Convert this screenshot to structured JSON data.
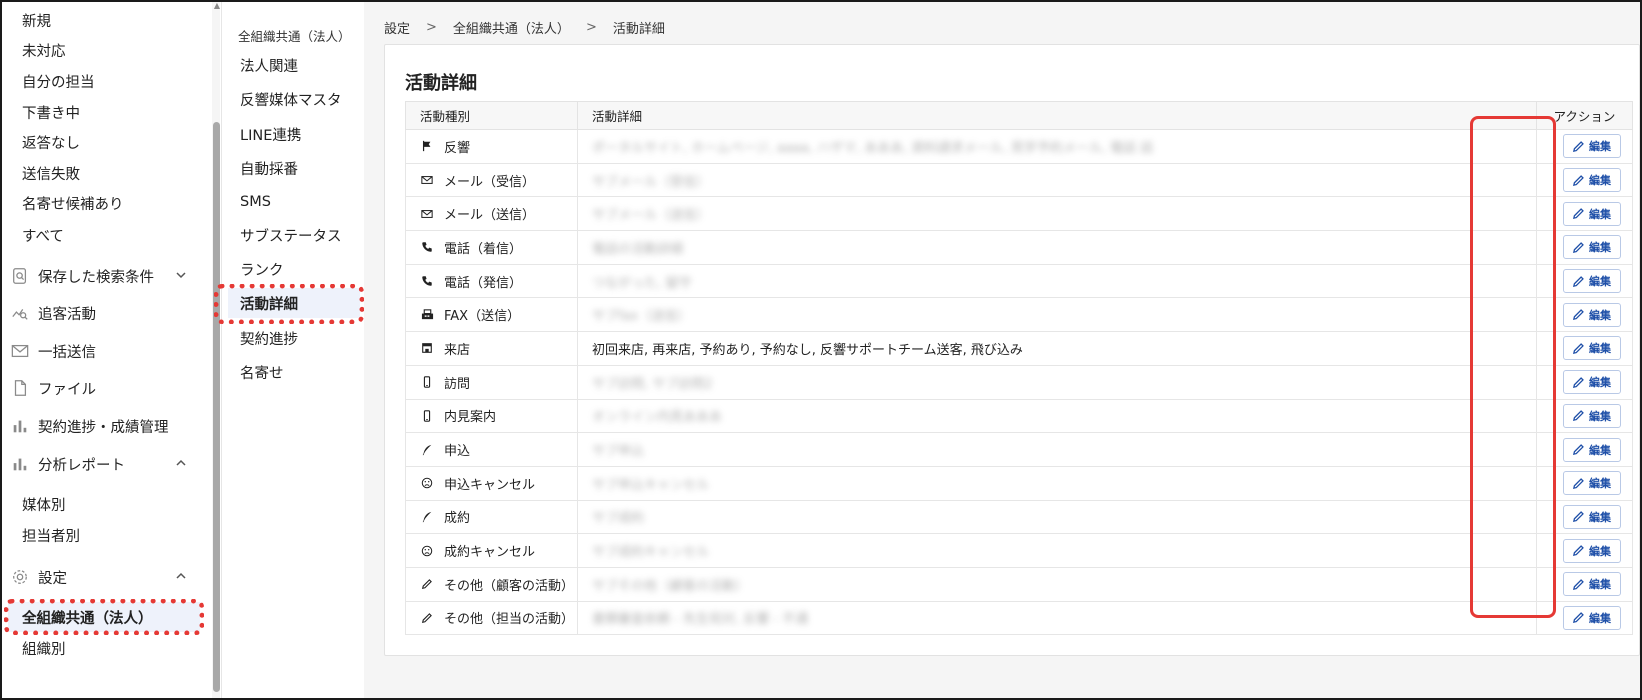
{
  "sidebar": {
    "sub_top": [
      {
        "label": "新規"
      },
      {
        "label": "未対応"
      },
      {
        "label": "自分の担当"
      },
      {
        "label": "下書き中"
      },
      {
        "label": "返答なし"
      },
      {
        "label": "送信失敗"
      },
      {
        "label": "名寄せ候補あり"
      },
      {
        "label": "すべて"
      }
    ],
    "saved_search": "保存した検索条件",
    "tracking": "追客活動",
    "bulk_send": "一括送信",
    "files": "ファイル",
    "contract": "契約進捗・成績管理",
    "analysis": "分析レポート",
    "analysis_items": [
      {
        "label": "媒体別"
      },
      {
        "label": "担当者別"
      }
    ],
    "settings": "設定",
    "settings_items": [
      {
        "label": "全組織共通（法人）"
      },
      {
        "label": "組織別"
      }
    ]
  },
  "subnav": {
    "title": "全組織共通（法人）",
    "items": [
      {
        "label": "法人関連"
      },
      {
        "label": "反響媒体マスタ"
      },
      {
        "label": "LINE連携"
      },
      {
        "label": "自動採番"
      },
      {
        "label": "SMS"
      },
      {
        "label": "サブステータス"
      },
      {
        "label": "ランク"
      },
      {
        "label": "活動詳細"
      },
      {
        "label": "契約進捗"
      },
      {
        "label": "名寄せ"
      }
    ]
  },
  "breadcrumb": {
    "items": [
      "設定",
      "全組織共通（法人）",
      "活動詳細"
    ],
    "separator": ">"
  },
  "page_title": "活動詳細",
  "table": {
    "headers": {
      "type": "活動種別",
      "detail": "活動詳細",
      "action": "アクション"
    },
    "edit_label": "編集",
    "rows": [
      {
        "type": "反響",
        "icon": "flag-icon",
        "detail": "ポータルサイト, ホームページ, aaaa, ハザマ, あああ, 資料請求メール, 見学予約メール, 電話 話",
        "blurred": true
      },
      {
        "type": "メール（受信）",
        "icon": "mail-icon",
        "detail": "サブメール（受信）",
        "blurred": true
      },
      {
        "type": "メール（送信）",
        "icon": "mail-icon",
        "detail": "サブメール（送信）",
        "blurred": true
      },
      {
        "type": "電話（着信）",
        "icon": "phone-icon",
        "detail": "電話の活動詳細",
        "blurred": true
      },
      {
        "type": "電話（発信）",
        "icon": "phone-icon",
        "detail": "つながった, 留守",
        "blurred": true
      },
      {
        "type": "FAX（送信）",
        "icon": "fax-icon",
        "detail": "サブfax（送信）",
        "blurred": true
      },
      {
        "type": "来店",
        "icon": "store-icon",
        "detail": "初回来店, 再来店, 予約あり, 予約なし, 反響サポートチーム送客, 飛び込み",
        "blurred": false
      },
      {
        "type": "訪問",
        "icon": "phone-device-icon",
        "detail": "サブ訪問, サブ訪問2",
        "blurred": true
      },
      {
        "type": "内見案内",
        "icon": "phone-device-icon",
        "detail": "オンライン内見あああ",
        "blurred": true
      },
      {
        "type": "申込",
        "icon": "feather-icon",
        "detail": "サブ申込",
        "blurred": true
      },
      {
        "type": "申込キャンセル",
        "icon": "sad-face-icon",
        "detail": "サブ申込キャンセル",
        "blurred": true
      },
      {
        "type": "成約",
        "icon": "feather-icon",
        "detail": "サブ成約",
        "blurred": true
      },
      {
        "type": "成約キャンセル",
        "icon": "sad-face-icon",
        "detail": "サブ成約キャンセル",
        "blurred": true
      },
      {
        "type": "その他（顧客の活動）",
        "icon": "pencil-icon",
        "detail": "サブその他（顧客の活動）",
        "blurred": true
      },
      {
        "type": "その他（担当の活動）",
        "icon": "pencil-icon",
        "detail": "書類審査依頼 - 先生宛対, 反響 - 不通",
        "blurred": true
      }
    ]
  },
  "colors": {
    "accent": "#1e4fa8",
    "highlight_red": "#e53935",
    "active_bg": "#eef2fb"
  }
}
